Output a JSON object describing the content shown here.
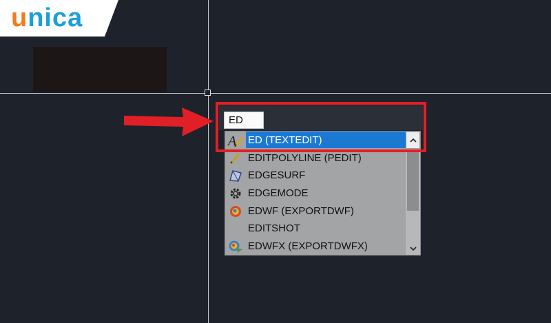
{
  "logo": {
    "first": "u",
    "rest": "nica",
    "color_orange": "#f07d1b",
    "color_blue": "#1c9fd9"
  },
  "command_line": {
    "value": "ED"
  },
  "autocomplete": {
    "items": [
      {
        "label": "ED (TEXTEDIT)",
        "icon": "text-edit-icon",
        "selected": true
      },
      {
        "label": "EDITPOLYLINE (PEDIT)",
        "icon": "pencil-icon"
      },
      {
        "label": "EDGESURF",
        "icon": "edge-surface-icon"
      },
      {
        "label": "EDGEMODE",
        "icon": "gear-icon"
      },
      {
        "label": "EDWF (EXPORTDWF)",
        "icon": "globe-icon"
      },
      {
        "label": "EDITSHOT",
        "icon": ""
      },
      {
        "label": "EDWFX (EXPORTDWFX)",
        "icon": "globe-export-icon"
      }
    ]
  },
  "colors": {
    "highlight": "#e11f26",
    "selection": "#1b79d4",
    "canvas": "#1e222a"
  }
}
